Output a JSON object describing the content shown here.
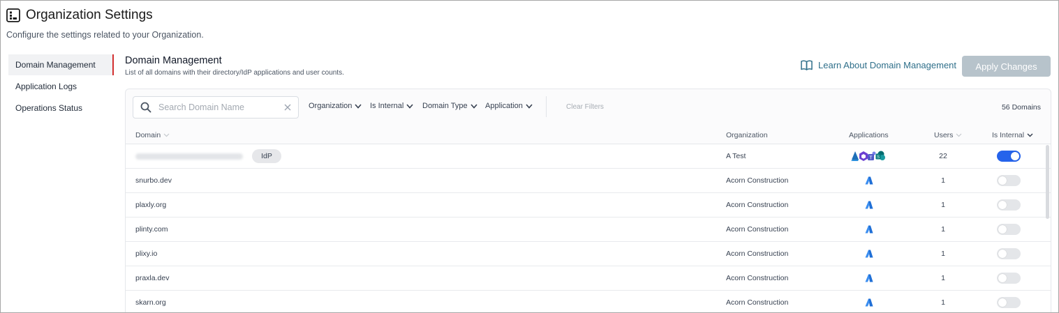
{
  "page": {
    "title": "Organization Settings",
    "subtitle": "Configure the settings related to your Organization."
  },
  "sidebar": {
    "items": [
      {
        "label": "Domain Management",
        "active": true
      },
      {
        "label": "Application Logs",
        "active": false
      },
      {
        "label": "Operations Status",
        "active": false
      }
    ]
  },
  "section": {
    "title": "Domain Management",
    "subtitle": "List of all domains with their directory/IdP applications and user counts.",
    "learn_link": "Learn About Domain Management",
    "apply_button": "Apply Changes"
  },
  "filters": {
    "search_placeholder": "Search Domain Name",
    "organization": "Organization",
    "is_internal": "Is Internal",
    "domain_type": "Domain Type",
    "application": "Application",
    "clear_filters": "Clear Filters",
    "domain_count": "56 Domains"
  },
  "table": {
    "columns": {
      "domain": "Domain",
      "organization": "Organization",
      "applications": "Applications",
      "users": "Users",
      "is_internal": "Is Internal"
    },
    "rows": [
      {
        "domain": "",
        "badge": "IdP",
        "organization": "A Test",
        "apps": [
          "azure-ad-icon",
          "entra-icon",
          "teams-icon",
          "sharepoint-icon"
        ],
        "users": "22",
        "is_internal": true
      },
      {
        "domain": "snurbo.dev",
        "organization": "Acorn Construction",
        "apps": [
          "azure-icon"
        ],
        "users": "1",
        "is_internal": false
      },
      {
        "domain": "plaxly.org",
        "organization": "Acorn Construction",
        "apps": [
          "azure-icon"
        ],
        "users": "1",
        "is_internal": false
      },
      {
        "domain": "plinty.com",
        "organization": "Acorn Construction",
        "apps": [
          "azure-icon"
        ],
        "users": "1",
        "is_internal": false
      },
      {
        "domain": "plixy.io",
        "organization": "Acorn Construction",
        "apps": [
          "azure-icon"
        ],
        "users": "1",
        "is_internal": false
      },
      {
        "domain": "praxla.dev",
        "organization": "Acorn Construction",
        "apps": [
          "azure-icon"
        ],
        "users": "1",
        "is_internal": false
      },
      {
        "domain": "skarn.org",
        "organization": "Acorn Construction",
        "apps": [
          "azure-icon"
        ],
        "users": "1",
        "is_internal": false
      }
    ]
  },
  "colors": {
    "accent_red": "#d32f2f",
    "toggle_on": "#2563eb",
    "link": "#2f6f8a",
    "apply_disabled": "#b7c3cb"
  }
}
